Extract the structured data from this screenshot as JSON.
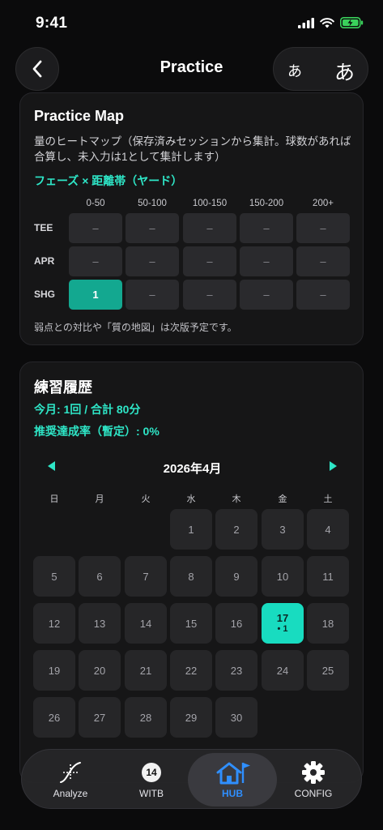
{
  "status": {
    "time": "9:41"
  },
  "nav": {
    "title": "Practice",
    "font_small": "あ",
    "font_large": "あ"
  },
  "practice_map": {
    "title": "Practice Map",
    "description": "量のヒートマップ（保存済みセッションから集計。球数があれば合算し、未入力は1として集計します）",
    "subtitle": "フェーズ × 距離帯（ヤード）",
    "columns": [
      "0-50",
      "50-100",
      "100-150",
      "150-200",
      "200+"
    ],
    "rows": [
      {
        "label": "TEE",
        "cells": [
          "–",
          "–",
          "–",
          "–",
          "–"
        ]
      },
      {
        "label": "APR",
        "cells": [
          "–",
          "–",
          "–",
          "–",
          "–"
        ]
      },
      {
        "label": "SHG",
        "cells": [
          "1",
          "–",
          "–",
          "–",
          "–"
        ]
      }
    ],
    "active_cell": {
      "row": 2,
      "col": 0
    },
    "note": "弱点との対比や「質の地図」は次版予定です。"
  },
  "history": {
    "title": "練習履歴",
    "month_summary": "今月: 1回 / 合計 80分",
    "achievement": "推奨達成率（暫定）: 0%",
    "calendar": {
      "month_label": "2026年4月",
      "weekdays": [
        "日",
        "月",
        "火",
        "水",
        "木",
        "金",
        "土"
      ],
      "first_weekday": 3,
      "days_in_month": 30,
      "today": 17,
      "today_marker": "• 1"
    }
  },
  "tabs": [
    {
      "label": "Analyze",
      "icon": "analyze-curve-icon"
    },
    {
      "label": "WITB",
      "icon": "witb-badge-icon",
      "badge": "14"
    },
    {
      "label": "HUB",
      "icon": "home-flag-icon",
      "active": true
    },
    {
      "label": "CONFIG",
      "icon": "gear-icon"
    }
  ],
  "colors": {
    "accent": "#2ee6c7",
    "active_cell": "#13a890",
    "today": "#18dcc0",
    "tab_active": "#2f8fff"
  }
}
